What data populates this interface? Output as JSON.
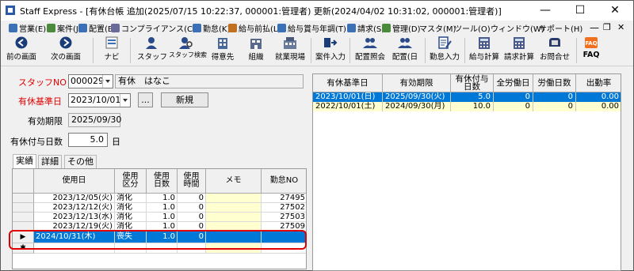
{
  "window": {
    "title": "Staff Express - [有休台帳  追加(2025/07/15 10:22:37, 000001:管理者) 更新(2024/04/02 10:31:02, 000001:管理者)]",
    "min": "—",
    "max": "☐",
    "close": "✕",
    "sub_min": "—",
    "sub_restore": "❐",
    "sub_close": "✕"
  },
  "menu": [
    {
      "label": "営業(E)",
      "color": "#3b6fb6"
    },
    {
      "label": "案件(J)",
      "color": "#4a8a3a"
    },
    {
      "label": "配置(B)",
      "color": "#3b6fb6"
    },
    {
      "label": "コンプライアンス(C)",
      "color": "#6a6a9a"
    },
    {
      "label": "勤怠(K)",
      "color": "#3b6fb6"
    },
    {
      "label": "給与前払(L)",
      "color": "#c07020"
    },
    {
      "label": "給与賞与年調(T)",
      "color": "#3b6fb6"
    },
    {
      "label": "請求(S)",
      "color": "#3b6fb6"
    },
    {
      "label": "管理(D)",
      "color": "#4a8a3a"
    },
    {
      "label": "マスタ(M)",
      "color": ""
    },
    {
      "label": "ツール(O)",
      "color": ""
    },
    {
      "label": "ウィンドウ(W)",
      "color": ""
    },
    {
      "label": "サポート(H)",
      "color": ""
    }
  ],
  "toolbar": [
    {
      "label": "前の画面",
      "icon": "back-arrow-icon"
    },
    {
      "label": "次の画面",
      "icon": "forward-arrow-icon"
    },
    {
      "label": "ナビ",
      "icon": "navi-icon"
    },
    {
      "label": "スタッフ",
      "icon": "staff-icon"
    },
    {
      "label": "スタッフ検索",
      "icon": "staff-search-icon"
    },
    {
      "label": "得意先",
      "icon": "customer-icon"
    },
    {
      "label": "組織",
      "icon": "organization-icon"
    },
    {
      "label": "就業現場",
      "icon": "workplace-icon"
    },
    {
      "label": "案件入力",
      "icon": "job-input-icon"
    },
    {
      "label": "配置照会",
      "icon": "assignment-inquiry-icon"
    },
    {
      "label": "配置(日",
      "icon": "assignment-daily-icon"
    },
    {
      "label": "勤怠入力",
      "icon": "attendance-input-icon"
    },
    {
      "label": "給与計算",
      "icon": "payroll-icon"
    },
    {
      "label": "請求計算",
      "icon": "billing-icon"
    },
    {
      "label": "お問合せ",
      "icon": "inquiry-icon"
    },
    {
      "label": "FAQ",
      "icon": "faq-icon"
    }
  ],
  "form": {
    "staff_label": "スタッフNO",
    "staff_no": "000029",
    "staff_name": "有休　はなこ",
    "base_date_label": "有休基準日",
    "base_date": "2023/10/01",
    "ellipsis": "...",
    "new_button": "新規",
    "expiry_label": "有効期限",
    "expiry_value": "2025/09/30",
    "grant_days_label": "有休付与日数",
    "grant_days_value": "5.0",
    "grant_days_unit": "日"
  },
  "tabs": [
    "実績",
    "詳細",
    "その他"
  ],
  "usage_table": {
    "headers": [
      "使用日",
      "使用\n区分",
      "使用\n日数",
      "使用\n時間",
      "メモ",
      "勤怠NO"
    ],
    "rows": [
      {
        "date": "2023/12/05(火)",
        "kind": "消化",
        "days": "1.0",
        "hours": "0",
        "memo": "",
        "no": "27495"
      },
      {
        "date": "2023/12/12(火)",
        "kind": "消化",
        "days": "1.0",
        "hours": "0",
        "memo": "",
        "no": "27502"
      },
      {
        "date": "2023/12/13(水)",
        "kind": "消化",
        "days": "1.0",
        "hours": "0",
        "memo": "",
        "no": "27503"
      },
      {
        "date": "2023/12/19(火)",
        "kind": "消化",
        "days": "1.0",
        "hours": "0",
        "memo": "",
        "no": "27509"
      },
      {
        "date": "2024/10/31(木)",
        "kind": "喪失",
        "days": "1.0",
        "hours": "0",
        "memo": "",
        "no": ""
      }
    ],
    "row_marker": "▶",
    "new_row_marker": "✱"
  },
  "grant_table": {
    "headers": [
      "有休基準日",
      "有効期限",
      "有休付与\n日数",
      "全労働日",
      "労働日数",
      "出勤率"
    ],
    "rows": [
      {
        "base": "2023/10/01(日)",
        "expiry": "2025/09/30(火)",
        "days": "5.0",
        "all_days": "0",
        "work_days": "0",
        "rate": "0.00"
      },
      {
        "base": "2022/10/01(土)",
        "expiry": "2024/09/30(月)",
        "days": "10.0",
        "all_days": "0",
        "work_days": "0",
        "rate": "0.00"
      }
    ]
  },
  "colors": {
    "selected": "#0078d7",
    "memo_yellow": "#ffffd0",
    "highlight_red": "#e00000"
  }
}
